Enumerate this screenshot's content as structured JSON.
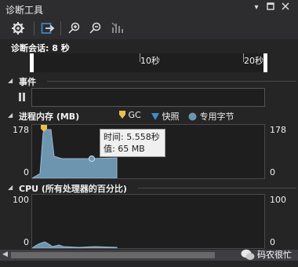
{
  "window": {
    "title": "诊断工具"
  },
  "session": {
    "label": "诊断会话: 8 秒"
  },
  "ruler": {
    "ticks": [
      "10秒",
      "20秒"
    ]
  },
  "events": {
    "title": "事件"
  },
  "memory": {
    "title": "进程内存 (MB)",
    "legend": {
      "gc": "GC",
      "snapshot": "快照",
      "private_bytes": "专用字节"
    },
    "y_max": "178",
    "y_min": "0",
    "tooltip": {
      "time": "时间: 5.558秒",
      "value": "值: 65 MB"
    }
  },
  "cpu": {
    "title": "CPU (所有处理器的百分比)",
    "y_max": "100",
    "y_min": "0"
  },
  "watermark": {
    "text": "码农很忙"
  },
  "colors": {
    "accent": "#3e8ed0",
    "series": "#6e95b0",
    "gc": "#e8c04a"
  }
}
